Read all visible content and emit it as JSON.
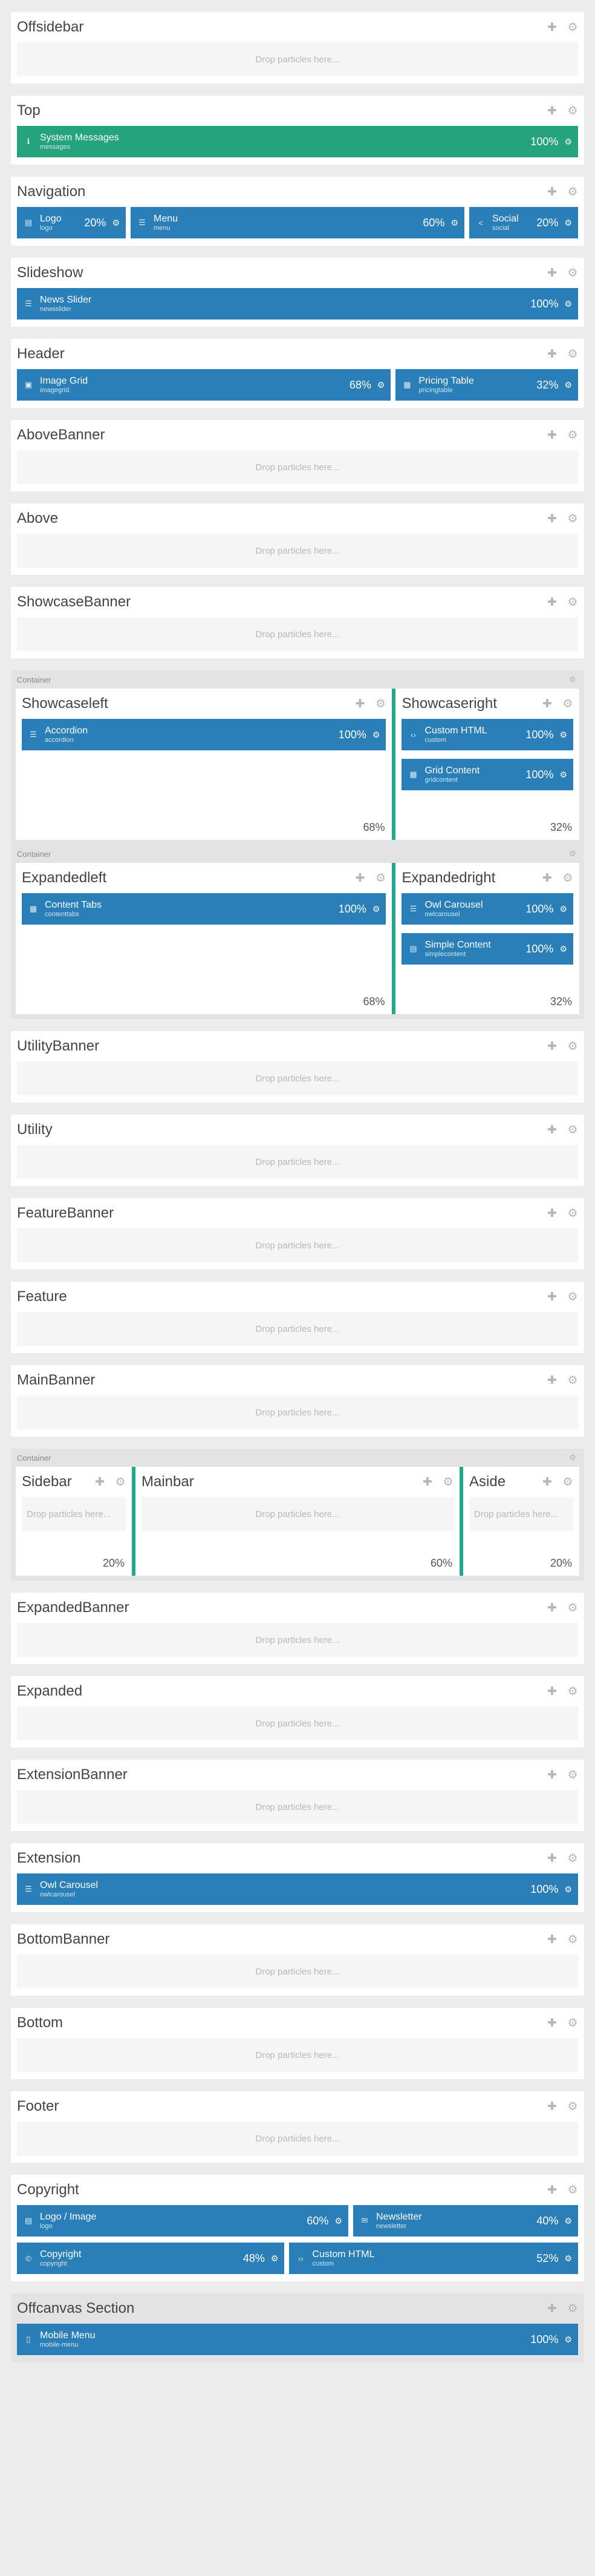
{
  "drop_text": "Drop particles here...",
  "container_label": "Container",
  "sections": {
    "offsidebar": {
      "title": "Offsidebar"
    },
    "top": {
      "title": "Top",
      "particle": {
        "title": "System Messages",
        "sub": "messages",
        "size": "100%"
      }
    },
    "navigation": {
      "title": "Navigation",
      "particles": [
        {
          "title": "Logo",
          "sub": "logo",
          "size": "20%"
        },
        {
          "title": "Menu",
          "sub": "menu",
          "size": "60%"
        },
        {
          "title": "Social",
          "sub": "social",
          "size": "20%"
        }
      ]
    },
    "slideshow": {
      "title": "Slideshow",
      "particle": {
        "title": "News Slider",
        "sub": "newsslider",
        "size": "100%"
      }
    },
    "header": {
      "title": "Header",
      "particles": [
        {
          "title": "Image Grid",
          "sub": "imagegrid",
          "size": "68%"
        },
        {
          "title": "Pricing Table",
          "sub": "pricingtable",
          "size": "32%"
        }
      ]
    },
    "abovebanner": {
      "title": "AboveBanner"
    },
    "above": {
      "title": "Above"
    },
    "showcasebanner": {
      "title": "ShowcaseBanner"
    },
    "showcaseleft": {
      "title": "Showcaseleft",
      "size": "68%",
      "particle": {
        "title": "Accordion",
        "sub": "accordion",
        "size": "100%"
      }
    },
    "showcaseright": {
      "title": "Showcaseright",
      "size": "32%",
      "particles": [
        {
          "title": "Custom HTML",
          "sub": "custom",
          "size": "100%"
        },
        {
          "title": "Grid Content",
          "sub": "gridcontent",
          "size": "100%"
        }
      ]
    },
    "expandedleft": {
      "title": "Expandedleft",
      "size": "68%",
      "particle": {
        "title": "Content Tabs",
        "sub": "contenttabs",
        "size": "100%"
      }
    },
    "expandedright": {
      "title": "Expandedright",
      "size": "32%",
      "particles": [
        {
          "title": "Owl Carousel",
          "sub": "owlcarousel",
          "size": "100%"
        },
        {
          "title": "Simple Content",
          "sub": "simplecontent",
          "size": "100%"
        }
      ]
    },
    "utilitybanner": {
      "title": "UtilityBanner"
    },
    "utility": {
      "title": "Utility"
    },
    "featurebanner": {
      "title": "FeatureBanner"
    },
    "feature": {
      "title": "Feature"
    },
    "mainbanner": {
      "title": "MainBanner"
    },
    "sidebar": {
      "title": "Sidebar",
      "size": "20%"
    },
    "mainbar": {
      "title": "Mainbar",
      "size": "60%"
    },
    "aside": {
      "title": "Aside",
      "size": "20%"
    },
    "expandedbanner": {
      "title": "ExpandedBanner"
    },
    "expanded": {
      "title": "Expanded"
    },
    "extensionbanner": {
      "title": "ExtensionBanner"
    },
    "extension": {
      "title": "Extension",
      "particle": {
        "title": "Owl Carousel",
        "sub": "owlcarousel",
        "size": "100%"
      }
    },
    "bottombanner": {
      "title": "BottomBanner"
    },
    "bottom": {
      "title": "Bottom"
    },
    "footer": {
      "title": "Footer"
    },
    "copyright": {
      "title": "Copyright",
      "particles": [
        {
          "title": "Logo / Image",
          "sub": "logo",
          "size": "60%"
        },
        {
          "title": "Newsletter",
          "sub": "newsletter",
          "size": "40%"
        },
        {
          "title": "Copyright",
          "sub": "copyright",
          "size": "48%"
        },
        {
          "title": "Custom HTML",
          "sub": "custom",
          "size": "52%"
        }
      ]
    },
    "offcanvas": {
      "title": "Offcanvas Section",
      "particle": {
        "title": "Mobile Menu",
        "sub": "mobile-menu",
        "size": "100%"
      }
    }
  },
  "icons": {
    "add": "plus-icon",
    "settings": "gear-icon"
  }
}
